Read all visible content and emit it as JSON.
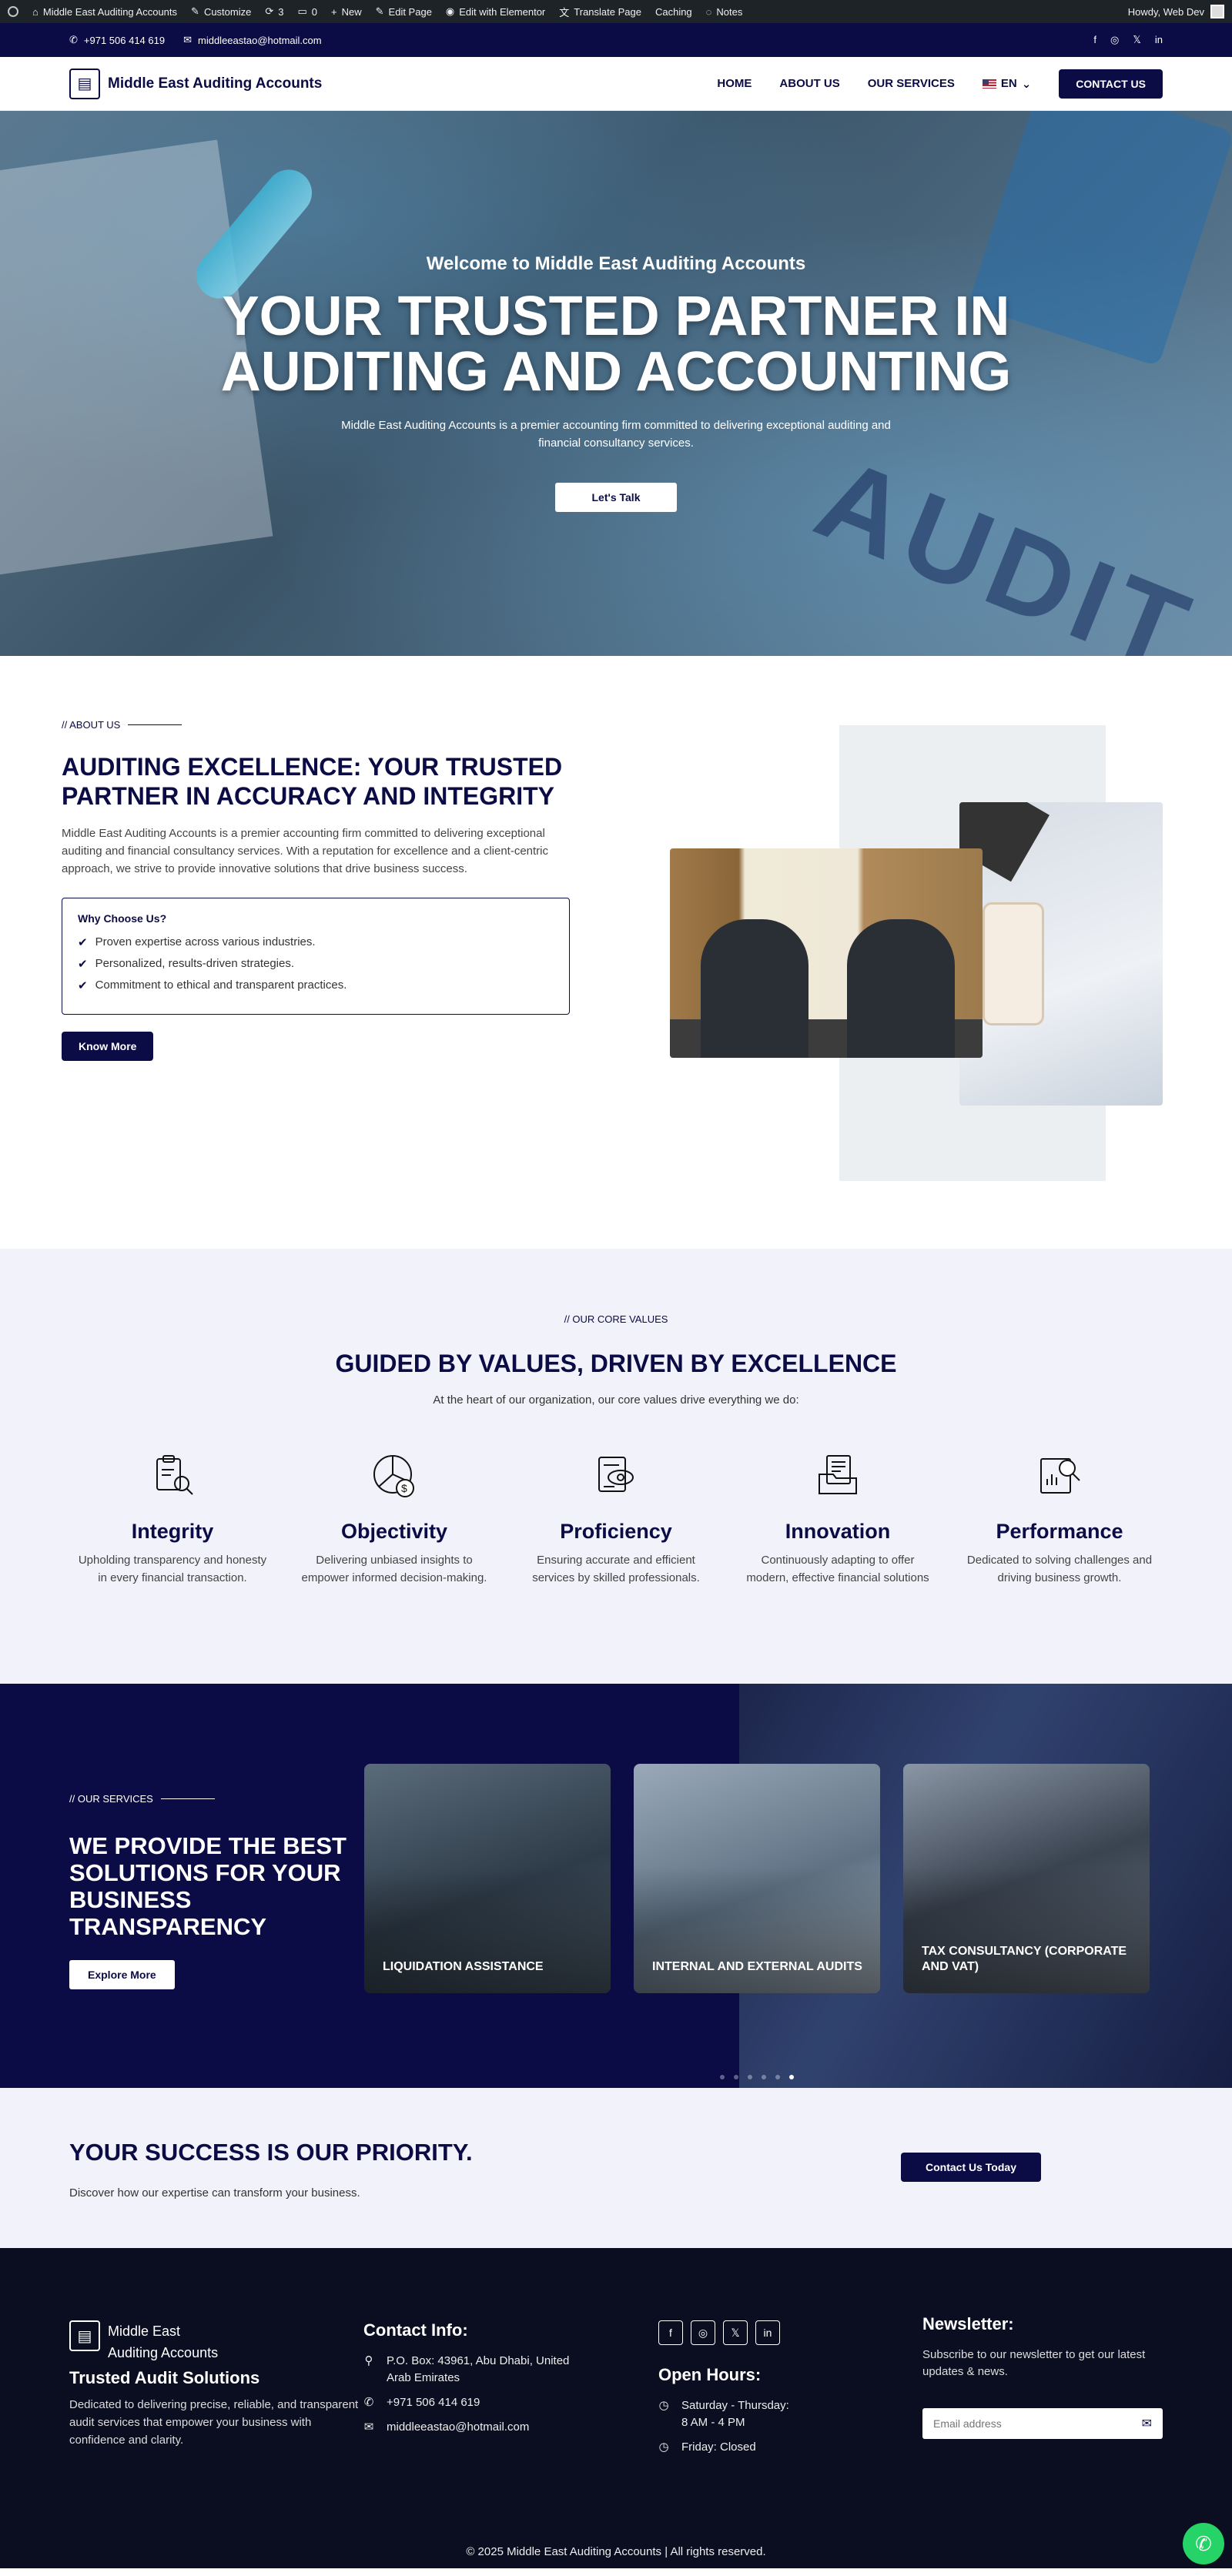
{
  "adminbar": {
    "site": "Middle East Auditing Accounts",
    "customize": "Customize",
    "updates": "3",
    "comments": "0",
    "new": "New",
    "edit_page": "Edit Page",
    "edit_elementor": "Edit with Elementor",
    "translate": "Translate Page",
    "caching": "Caching",
    "notes": "Notes",
    "user": "Howdy, Web Dev"
  },
  "topbar": {
    "phone": "+971 506 414 619",
    "email": "middleeastao@hotmail.com"
  },
  "header": {
    "logo": "Middle East Auditing Accounts",
    "nav": [
      "HOME",
      "ABOUT US",
      "OUR SERVICES"
    ],
    "lang": "EN",
    "contact": "CONTACT US"
  },
  "hero": {
    "welcome": "Welcome to Middle East Auditing Accounts",
    "title_line1": "YOUR TRUSTED PARTNER IN",
    "title_line2": "AUDITING AND ACCOUNTING",
    "subtitle": "Middle East Auditing Accounts is a premier accounting firm committed to delivering exceptional auditing and financial consultancy services.",
    "button": "Let's Talk",
    "image_text": "AUDIT"
  },
  "about": {
    "eyebrow": "// ABOUT US",
    "title": "AUDITING EXCELLENCE: YOUR TRUSTED PARTNER IN ACCURACY AND INTEGRITY",
    "description": "Middle East Auditing Accounts is a premier accounting firm committed to delivering exceptional auditing and financial consultancy services. With a reputation for excellence and a client-centric approach, we strive to provide innovative solutions that drive business success.",
    "why_title": "Why Choose Us?",
    "why_items": [
      "Proven expertise across various industries.",
      "Personalized, results-driven strategies.",
      "Commitment to ethical and transparent practices."
    ],
    "button": "Know More"
  },
  "values": {
    "eyebrow": "// OUR CORE VALUES",
    "title": "GUIDED BY VALUES, DRIVEN BY EXCELLENCE",
    "subtitle": "At the heart of our organization, our core values drive everything we do:",
    "items": [
      {
        "title": "Integrity",
        "text": "Upholding transparency and honesty in every financial transaction.",
        "icon": "clipboard-search-icon"
      },
      {
        "title": "Objectivity",
        "text": "Delivering unbiased insights to empower informed decision-making.",
        "icon": "pie-chart-dollar-icon"
      },
      {
        "title": "Proficiency",
        "text": "Ensuring accurate and efficient services by skilled professionals.",
        "icon": "document-eye-icon"
      },
      {
        "title": "Innovation",
        "text": "Continuously adapting to offer modern, effective financial solutions",
        "icon": "folder-document-icon"
      },
      {
        "title": "Performance",
        "text": "Dedicated to solving challenges and driving business growth.",
        "icon": "report-magnifier-icon"
      }
    ]
  },
  "services": {
    "eyebrow": "// OUR SERVICES",
    "title": "WE PROVIDE THE BEST SOLUTIONS FOR YOUR BUSINESS TRANSPARENCY",
    "button": "Explore More",
    "cards": [
      "LIQUIDATION ASSISTANCE",
      "INTERNAL AND EXTERNAL AUDITS",
      "TAX CONSULTANCY (CORPORATE AND VAT)"
    ],
    "slides": 6,
    "active_slide": 6
  },
  "cta": {
    "title": "YOUR SUCCESS IS OUR PRIORITY.",
    "subtitle": "Discover how our expertise can transform your business.",
    "button": "Contact Us Today"
  },
  "footer": {
    "logo_line1": "Middle East",
    "logo_line2": "Auditing Accounts",
    "tagline": "Trusted Audit Solutions",
    "about": "Dedicated to delivering precise, reliable, and transparent audit services that empower your business with confidence and clarity.",
    "contact_title": "Contact Info:",
    "address": "P.O. Box: 43961, Abu Dhabi, United Arab Emirates",
    "phone": "+971 506 414 619",
    "email": "middleeastao@hotmail.com",
    "hours_title": "Open Hours:",
    "hours1": "Saturday - Thursday:",
    "hours1b": "8 AM - 4 PM",
    "hours2": "Friday: Closed",
    "newsletter_title": "Newsletter:",
    "newsletter_text": "Subscribe to our newsletter to get our latest updates & news.",
    "email_placeholder": "Email address",
    "copyright": "© 2025 Middle East Auditing Accounts | All rights reserved."
  },
  "colors": {
    "navy": "#0b0b45",
    "footer": "#0a0e20",
    "light": "#f2f2fa",
    "whatsapp": "#25d366"
  }
}
